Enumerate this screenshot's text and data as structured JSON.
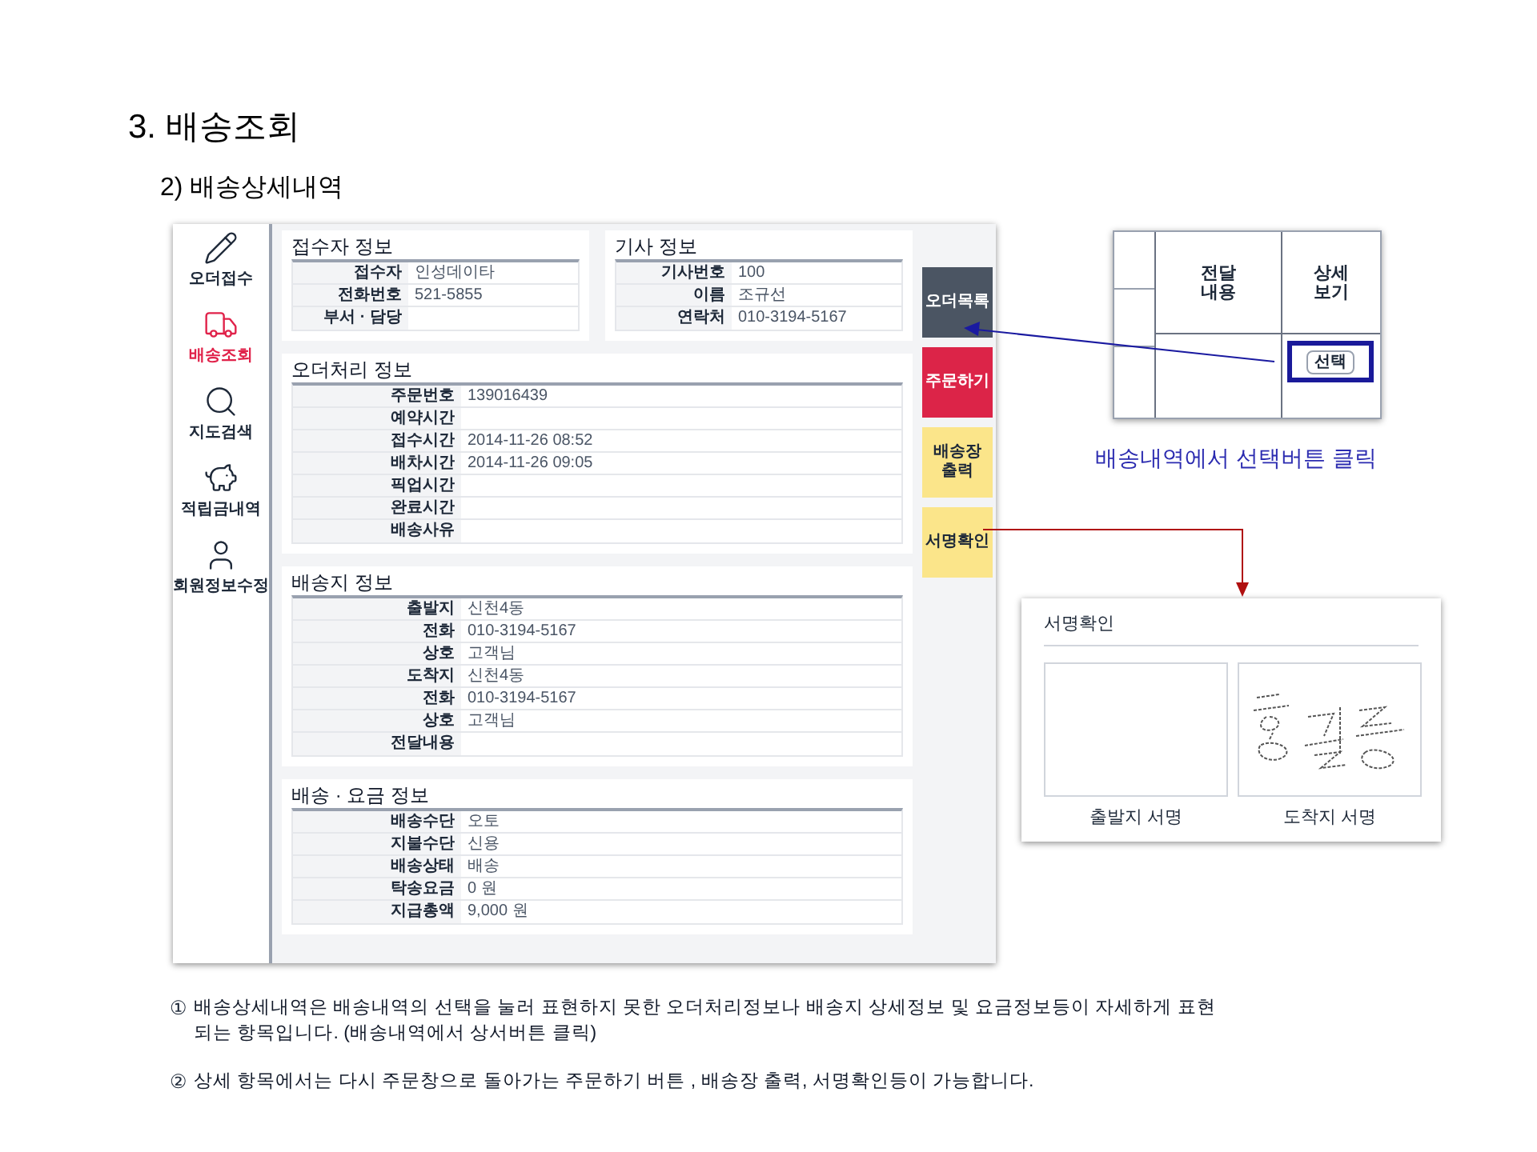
{
  "slide": {
    "title": "3. 배송조회",
    "subtitle": "2) 배송상세내역"
  },
  "app": {
    "sidebar": [
      {
        "label": "오더접수",
        "selected": false
      },
      {
        "label": "배송조회",
        "selected": true
      },
      {
        "label": "지도검색",
        "selected": false
      },
      {
        "label": "적립금내역",
        "selected": false
      },
      {
        "label": "회원정보수정",
        "selected": false
      }
    ],
    "top_cards": [
      {
        "title": "접수자 정보",
        "rows": [
          {
            "label": "접수자",
            "value": "인성데이타"
          },
          {
            "label": "전화번호",
            "value": "521-5855"
          },
          {
            "label": "부서 · 담당"
          }
        ]
      },
      {
        "title": "기사 정보",
        "rows": [
          {
            "label": "기사번호",
            "value": "100"
          },
          {
            "label": "이름",
            "value": "조규선"
          },
          {
            "label": "연락처",
            "value": "010-3194-5167"
          }
        ]
      }
    ],
    "sections": [
      {
        "title": "오더처리 정보",
        "rows": [
          {
            "label": "주문번호",
            "value": "139016439"
          },
          {
            "label": "예약시간"
          },
          {
            "label": "접수시간",
            "value": "2014-11-26 08:52"
          },
          {
            "label": "배차시간",
            "value": "2014-11-26 09:05"
          },
          {
            "label": "픽업시간"
          },
          {
            "label": "완료시간"
          },
          {
            "label": "배송사유"
          }
        ]
      },
      {
        "title": "배송지 정보",
        "rows": [
          {
            "label": "출발지",
            "value": "신천4동"
          },
          {
            "label": "전화",
            "value": "010-3194-5167"
          },
          {
            "label": "상호",
            "value": "고객님"
          },
          {
            "label": "도착지",
            "value": "신천4동"
          },
          {
            "label": "전화",
            "value": "010-3194-5167"
          },
          {
            "label": "상호",
            "value": "고객님"
          },
          {
            "label": "전달내용"
          }
        ]
      },
      {
        "title": "배송 · 요금 정보",
        "rows": [
          {
            "label": "배송수단",
            "value": "오토"
          },
          {
            "label": "지불수단",
            "value": "신용"
          },
          {
            "label": "배송상태",
            "value": "배송"
          },
          {
            "label": "탁송요금",
            "value": "0 원"
          },
          {
            "label": "지급총액",
            "value": "9,000 원"
          }
        ]
      }
    ],
    "action_buttons": [
      {
        "label": "오더목록",
        "color": "#4b5563"
      },
      {
        "label": "주문하기",
        "color": "#dc2448"
      },
      {
        "label": "배송장 출력",
        "color": "#fbe58a"
      },
      {
        "label": "서명확인",
        "color": "#fbe58a"
      }
    ]
  },
  "inset": {
    "columns": [
      "전달 내용",
      "상세 보기"
    ],
    "button": "선택"
  },
  "inset_caption": "배송내역에서 선택버튼 클릭",
  "signature_panel": {
    "title": "서명확인",
    "boxes": [
      {
        "label": "출발지 서명",
        "signed": false
      },
      {
        "label": "도착지 서명",
        "signed": true
      }
    ]
  },
  "notes": [
    {
      "marker": "①",
      "text": "배송상세내역은 배송내역의 선택을 눌러 표현하지 못한 오더처리정보나 배송지 상세정보 및 요금정보등이 자세하게 표현되는 항목입니다. (배송내역에서 상서버튼 클릭)"
    },
    {
      "marker": "②",
      "text": "상세 항목에서는 다시 주문창으로 돌아가는 주문하기 버튼 , 배송장 출력, 서명확인등이 가능합니다."
    }
  ]
}
